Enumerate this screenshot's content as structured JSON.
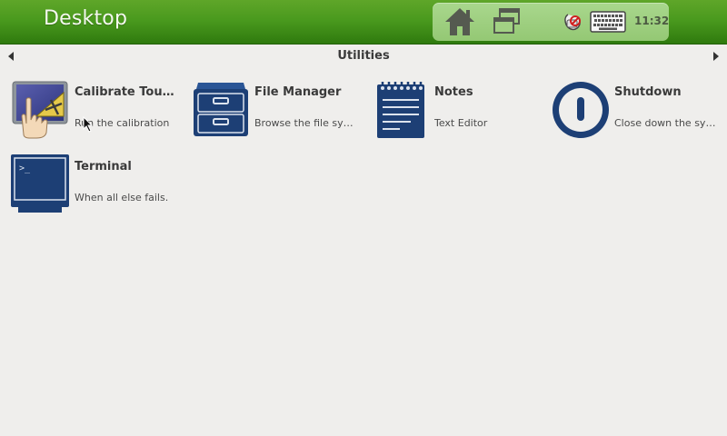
{
  "header": {
    "title": "Desktop",
    "clock": "11:32",
    "buttons": [
      {
        "icon": "home-icon"
      },
      {
        "icon": "switch-windows-icon"
      },
      {
        "icon": "keyboard-mouse-indicator-icon"
      },
      {
        "icon": "onscreen-keyboard-icon"
      }
    ]
  },
  "category": {
    "title": "Utilities"
  },
  "apps": [
    {
      "name": "Calibrate Touchscreen",
      "description": "Run the calibration",
      "icon": "calibrate-touchscreen-icon"
    },
    {
      "name": "File Manager",
      "description": "Browse the file system",
      "icon": "file-cabinet-icon"
    },
    {
      "name": "Notes",
      "description": "Text Editor",
      "icon": "notepad-icon"
    },
    {
      "name": "Shutdown",
      "description": "Close down the system",
      "icon": "power-icon"
    },
    {
      "name": "Terminal",
      "description": "When all else fails.",
      "icon": "terminal-icon"
    }
  ],
  "colors": {
    "header_green": "#4a9a1e",
    "panel_green": "#a2d184",
    "icon_navy": "#1d3f75",
    "background": "#efeeec"
  }
}
